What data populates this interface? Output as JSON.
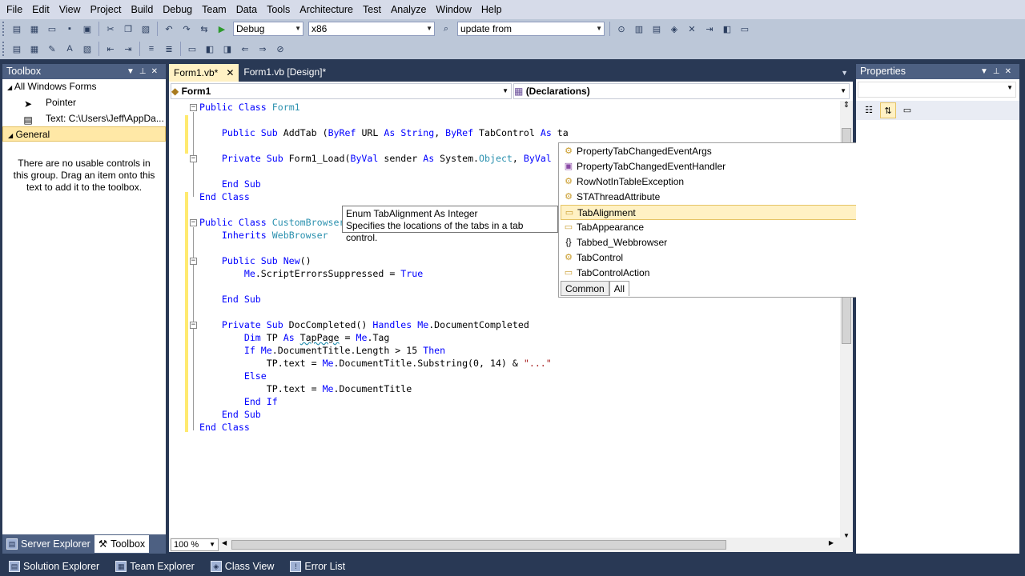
{
  "menu": [
    "File",
    "Edit",
    "View",
    "Project",
    "Build",
    "Debug",
    "Team",
    "Data",
    "Tools",
    "Architecture",
    "Test",
    "Analyze",
    "Window",
    "Help"
  ],
  "toolbar": {
    "configuration": "Debug",
    "platform": "x86",
    "find": "update from"
  },
  "toolbox": {
    "title": "Toolbox",
    "group_windows_forms": "All Windows Forms",
    "item_pointer": "Pointer",
    "item_text": "Text: C:\\Users\\Jeff\\AppDa...",
    "group_general": "General",
    "empty_message": "There are no usable controls in this group. Drag an item onto this text to add it to the toolbox.",
    "tab_server_explorer": "Server Explorer",
    "tab_toolbox": "Toolbox"
  },
  "editor": {
    "tab_active": "Form1.vb*",
    "tab_design": "Form1.vb [Design]*",
    "nav_class": "Form1",
    "nav_member": "(Declarations)",
    "zoom": "100 %"
  },
  "tooltip": {
    "line1": "Enum TabAlignment As Integer",
    "line2": "Specifies the locations of the tabs in a tab control."
  },
  "intellisense": {
    "items": [
      {
        "label": "PropertyTabChangedEventArgs",
        "icon": "class-icon"
      },
      {
        "label": "PropertyTabChangedEventHandler",
        "icon": "delegate-icon"
      },
      {
        "label": "RowNotInTableException",
        "icon": "class-icon"
      },
      {
        "label": "STAThreadAttribute",
        "icon": "class-icon"
      },
      {
        "label": "TabAlignment",
        "icon": "enum-icon"
      },
      {
        "label": "TabAppearance",
        "icon": "enum-icon"
      },
      {
        "label": "Tabbed_Webbrowser",
        "icon": "namespace-icon"
      },
      {
        "label": "TabControl",
        "icon": "class-icon"
      },
      {
        "label": "TabControlAction",
        "icon": "enum-icon"
      }
    ],
    "selected_index": 4,
    "tab_common": "Common",
    "tab_all": "All"
  },
  "properties": {
    "title": "Properties"
  },
  "bottom_tabs": [
    "Solution Explorer",
    "Team Explorer",
    "Class View",
    "Error List"
  ]
}
